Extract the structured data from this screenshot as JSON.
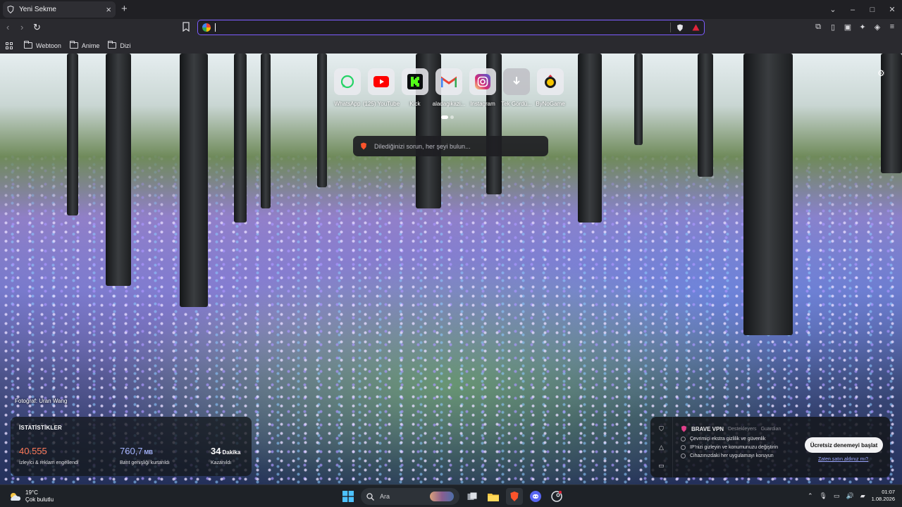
{
  "tab": {
    "title": "Yeni Sekme",
    "close": "×",
    "new_tab": "+"
  },
  "window_controls": {
    "minimize": "–",
    "maximize": "□",
    "close": "✕",
    "dropdown": "⌄"
  },
  "toolbar": {
    "back": "‹",
    "forward": "›",
    "reload": "↻",
    "url_value": "",
    "url_placeholder": ""
  },
  "bookmarks": [
    {
      "label": "Webtoon"
    },
    {
      "label": "Anime"
    },
    {
      "label": "Dizi"
    }
  ],
  "top_sites": [
    {
      "label": "WhatsApp",
      "icon": "whatsapp-icon",
      "color": "#25d366"
    },
    {
      "label": "(125) YouTube",
      "icon": "youtube-icon",
      "color": "#ff0000"
    },
    {
      "label": "Kick",
      "icon": "kick-icon",
      "color": "#53fc18"
    },
    {
      "label": "aladagikazi...",
      "icon": "gmail-icon",
      "color": "#ea4335"
    },
    {
      "label": "Instagram",
      "icon": "instagram-icon",
      "color": "#d62976"
    },
    {
      "label": "Tek Gördü...",
      "icon": "download-icon",
      "color": "#e6e6ea"
    },
    {
      "label": "ByNoGame",
      "icon": "bynogame-icon",
      "color": "#f7c600"
    }
  ],
  "leo": {
    "placeholder": "Dilediğinizi sorun, her şeyi bulun..."
  },
  "photo_credit": "Fotoğraf: Uran Wang",
  "stats": {
    "title": "İSTATİSTİKLER",
    "items": [
      {
        "value": "40.555",
        "unit": "",
        "desc": "İzleyici & reklam engellendi",
        "color": "#ff7a59"
      },
      {
        "value": "760,7",
        "unit": "MB",
        "desc": "Bant genişliği kurtarıldı",
        "color": "#a5b4ff"
      },
      {
        "value": "34",
        "unit": "Dakika",
        "desc": "Kazanıldı",
        "color": "#ffffff"
      }
    ]
  },
  "vpn": {
    "title": "BRAVE VPN",
    "supporters": "Destekleyers",
    "partner": "Guardian",
    "features": [
      "Çevrimiçi ekstra gizlilik ve güvenlik",
      "IP'nizi gizleyin ve konumunuzu değiştirin",
      "Cihazınızdaki her uygulamayı koruyun"
    ],
    "cta": "Ücretsiz denemeyi başlat",
    "link": "Zaten satın aldınız mı?"
  },
  "taskbar": {
    "weather_temp": "19°C",
    "weather_desc": "Çok bulutlu",
    "search_label": "Ara",
    "time": "01:07",
    "date": "1.08.2026"
  }
}
